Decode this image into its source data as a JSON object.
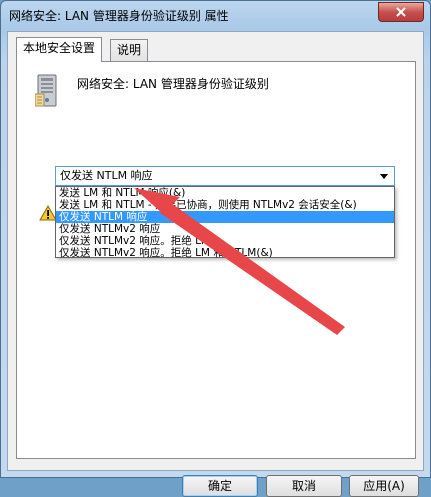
{
  "window": {
    "title": "网络安全: LAN 管理器身份验证级别 属性"
  },
  "tabs": [
    {
      "label": "本地安全设置"
    },
    {
      "label": "说明"
    }
  ],
  "policy": {
    "title": "网络安全: LAN 管理器身份验证级别"
  },
  "select": {
    "value": "仅发送 NTLM 响应"
  },
  "dropdown": {
    "options": [
      "发送 LM 和 NTLM 响应(&)",
      "发送 LM 和 NTLM - 如果已协商，则使用 NTLMv2 会话安全(&)",
      "仅发送 NTLM 响应",
      "仅发送 NTLMv2 响应",
      "仅发送 NTLMv2 响应。拒绝 LM",
      "仅发送 NTLMv2 响应。拒绝 LM 和 NTLM(&)"
    ],
    "selected_index": 2
  },
  "buttons": {
    "ok": "确定",
    "cancel": "取消",
    "apply": "应用(A)"
  },
  "colors": {
    "selection": "#3399ff",
    "arrow": "#e8474a",
    "title_bar": "#a9c9e8"
  }
}
